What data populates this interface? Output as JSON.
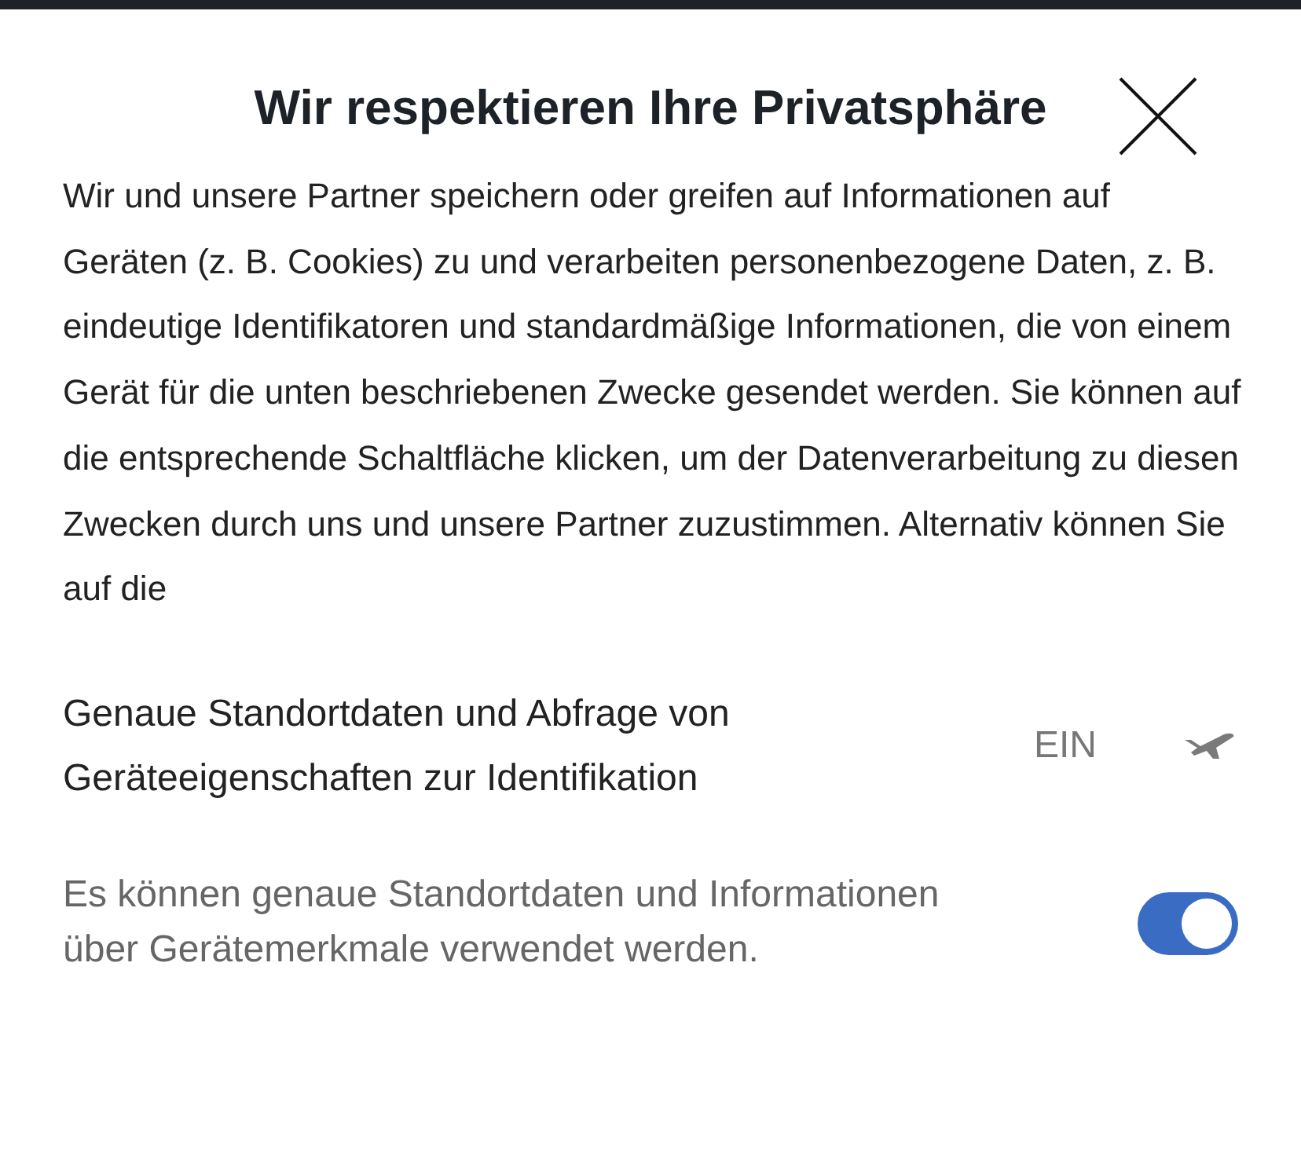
{
  "dialog": {
    "title": "Wir respektieren Ihre Privatsphäre",
    "intro": "Wir und unsere Partner speichern oder greifen auf Informationen auf Geräten (z. B. Cookies) zu und verarbeiten personenbezogene Daten, z. B. eindeutige Identifikatoren und standardmäßige Informationen, die von einem Gerät für die unten beschriebenen Zwecke gesendet werden. Sie können auf die entsprechende Schaltfläche klicken, um der Datenverarbeitung zu diesen Zwecken durch uns und unsere Partner zuzustimmen. Alternativ können Sie auf die",
    "purposes": [
      {
        "title": "Genaue Standortdaten und Abfrage von Geräteeigenschaften zur Identifikation",
        "status": "EIN",
        "on": true,
        "description": "Es können genaue Standortdaten und Informationen über Gerätemerkmale verwendet werden."
      }
    ]
  }
}
